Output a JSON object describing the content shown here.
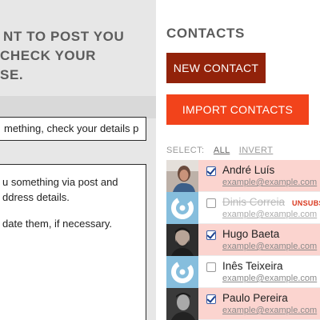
{
  "left": {
    "title_lines": [
      "NT TO POST YOU",
      "CHECK YOUR",
      "SE."
    ],
    "subject_value": "mething, check your details p",
    "message_lines": [
      "u something via post and",
      "ddress details.",
      "date them, if necessary."
    ]
  },
  "contacts": {
    "title": "CONTACTS",
    "new_contact_label": "NEW CONTACT",
    "import_contacts_label": "IMPORT CONTACTS",
    "select_label": "SELECT:",
    "select_all_label": "ALL",
    "select_invert_label": "INVERT",
    "items": [
      {
        "name": "André Luís",
        "email": "example@example.com",
        "checked": true,
        "unsubscribed": false,
        "avatar": "photo-avatar"
      },
      {
        "name": "Dinis Correia",
        "email": "example@example.com",
        "checked": false,
        "unsubscribed": true,
        "badge": "UNSUBS",
        "avatar": "generic-avatar"
      },
      {
        "name": "Hugo Baeta",
        "email": "example@example.com",
        "checked": true,
        "unsubscribed": false,
        "avatar": "photo-avatar"
      },
      {
        "name": "Inês Teixeira",
        "email": "example@example.com",
        "checked": false,
        "unsubscribed": false,
        "avatar": "generic-avatar"
      },
      {
        "name": "Paulo Pereira",
        "email": "example@example.com",
        "checked": true,
        "unsubscribed": false,
        "avatar": "photo-avatar"
      }
    ]
  },
  "colors": {
    "accent_dark": "#92220a",
    "accent": "#f2431b",
    "selected_row": "#fbd4cf",
    "generic_avatar": "#86bedd"
  }
}
